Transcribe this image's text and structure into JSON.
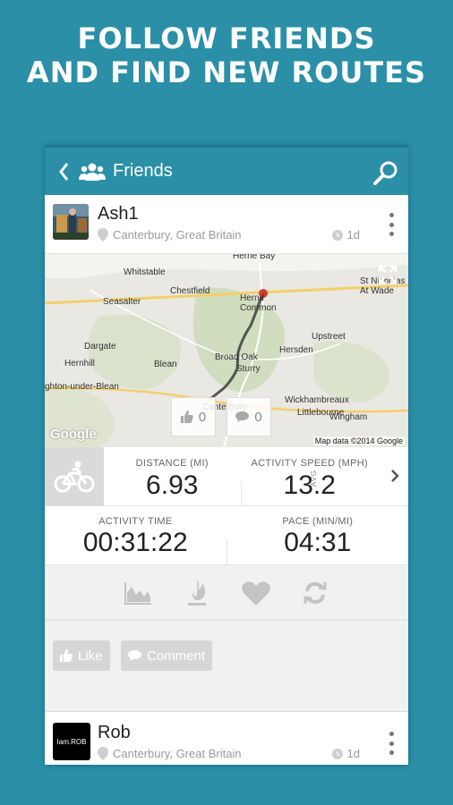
{
  "promo": {
    "line1": "FOLLOW FRIENDS",
    "line2": "AND FIND NEW ROUTES"
  },
  "appbar": {
    "title": "Friends"
  },
  "posts": [
    {
      "user": "Ash1",
      "location": "Canterbury, Great Britain",
      "time": "1d",
      "map": {
        "places": [
          "Herne Bay",
          "Whitstable",
          "Chestfield",
          "Herne Common",
          "St Nicholas At Wade",
          "Seasalter",
          "Upstreet",
          "Dargate",
          "Hernhill",
          "Blean",
          "Broad Oak",
          "Hersden",
          "Sturry",
          "ghton-under-Blean",
          "Canterbury",
          "Wickhambreaux",
          "Littlebourne",
          "Wingham"
        ],
        "likes": "0",
        "comments": "0",
        "google": "Google",
        "attribution": "Map data ©2014 Google"
      },
      "stats": {
        "distance_label": "DISTANCE (MI)",
        "distance": "6.93",
        "speed_label": "ACTIVITY SPEED (MPH)",
        "speed": "13.2",
        "speed_suffix": "AVG",
        "time_label": "ACTIVITY TIME",
        "time": "00:31:22",
        "pace_label": "PACE (MIN/MI)",
        "pace": "04:31"
      },
      "like_label": "Like",
      "comment_label": "Comment"
    },
    {
      "user": "Rob",
      "avatar_text": "Iam.ROB",
      "location": "Canterbury, Great Britain",
      "time": "1d"
    }
  ],
  "colors": {
    "brand": "#2a8fa7",
    "icon_grey": "#c4c4c4"
  }
}
